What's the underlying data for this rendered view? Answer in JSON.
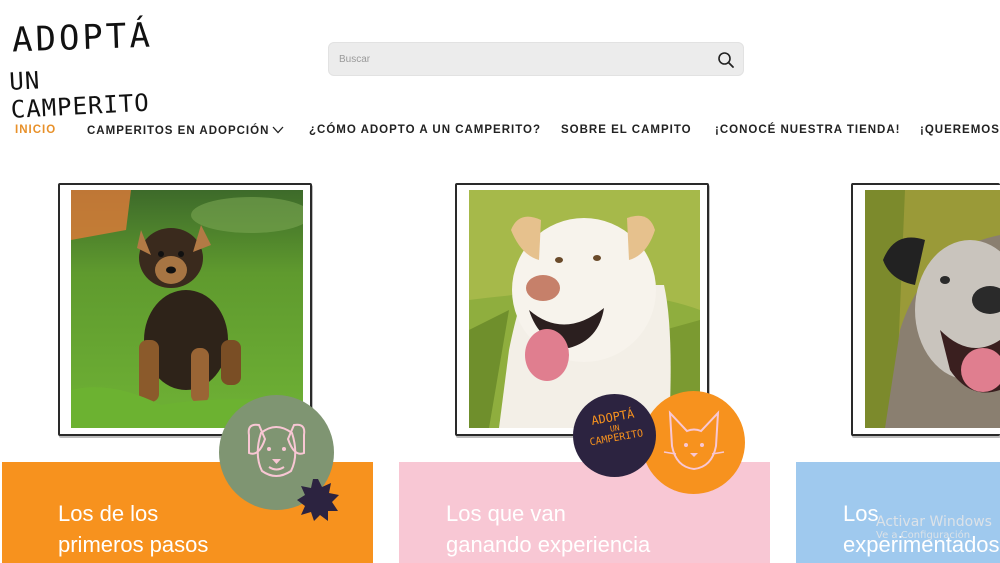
{
  "logo": {
    "line1": "ADOPTÁ",
    "line2": "UN CAMPERITO"
  },
  "search": {
    "placeholder": "Buscar",
    "icon": "search-icon"
  },
  "nav": {
    "items": [
      {
        "label": "INICIO",
        "active": true
      },
      {
        "label": "CAMPERITOS EN ADOPCIÓN",
        "has_dropdown": true
      },
      {
        "label": "¿CÓMO ADOPTO A UN CAMPERITO?"
      },
      {
        "label": "SOBRE EL CAMPITO"
      },
      {
        "label": "¡CONOCÉ NUESTRA TIENDA!"
      },
      {
        "label": "¡QUEREMOS C"
      }
    ]
  },
  "cards": [
    {
      "title_line1": "Los de los",
      "title_line2": "primeros pasos",
      "banner_color": "#f7921e",
      "badge_icon": "puppy-icon",
      "badge_color": "#7f9572"
    },
    {
      "title_line1": "Los que van",
      "title_line2": "ganando experiencia",
      "banner_color": "#f8c7d4",
      "badge_icon": "cat-icon",
      "badge_color": "#f7921e",
      "stamp": {
        "line1": "ADOPTÁ",
        "line2": "UN",
        "line3": "CAMPERITO"
      }
    },
    {
      "title_line1": "Los",
      "title_line2": "experimentados",
      "banner_color": "#9fc9ee"
    }
  ],
  "watermark": {
    "line1": "Activar Windows",
    "line2": "Ve a Configuración"
  },
  "colors": {
    "accent": "#e8912a",
    "text": "#222222"
  }
}
